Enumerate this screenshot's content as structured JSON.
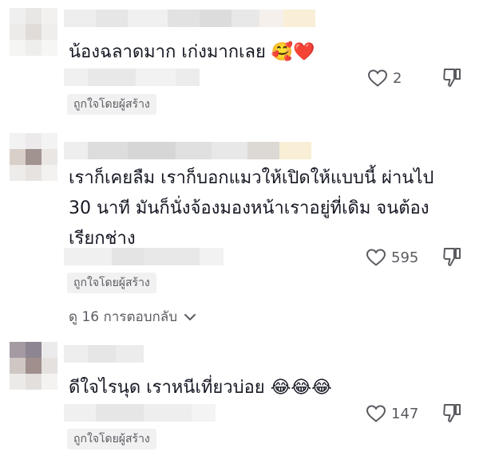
{
  "comments": [
    {
      "text": "น้องฉลาดมาก เก่งมากเลย",
      "emojis": "🥰❤️",
      "likes": "2",
      "creator_badge": "ถูกใจโดยผู้สร้าง"
    },
    {
      "text": "เราก็เคยลืม เราก็บอกแมวให้เปิดให้แบบนี้ ผ่านไป 30 นาที มันก็นั่งจ้องมองหน้าเราอยู่ที่เดิม จนต้องเรียกช่าง",
      "likes": "595",
      "creator_badge": "ถูกใจโดยผู้สร้าง",
      "replies_label": "ดู 16 การตอบกลับ"
    },
    {
      "text": "ดีใจไรนุด เราหนีเที่ยวบ่อย",
      "emojis": "😂😂😂",
      "likes": "147",
      "creator_badge": "ถูกใจโดยผู้สร้าง"
    }
  ],
  "icons": {
    "like": "heart-outline-icon",
    "dislike": "thumb-down-outline-icon",
    "expand": "chevron-down-icon"
  },
  "colors": {
    "text": "#161823",
    "secondary": "#5a5b60",
    "badge_bg": "#f1f1f2"
  }
}
